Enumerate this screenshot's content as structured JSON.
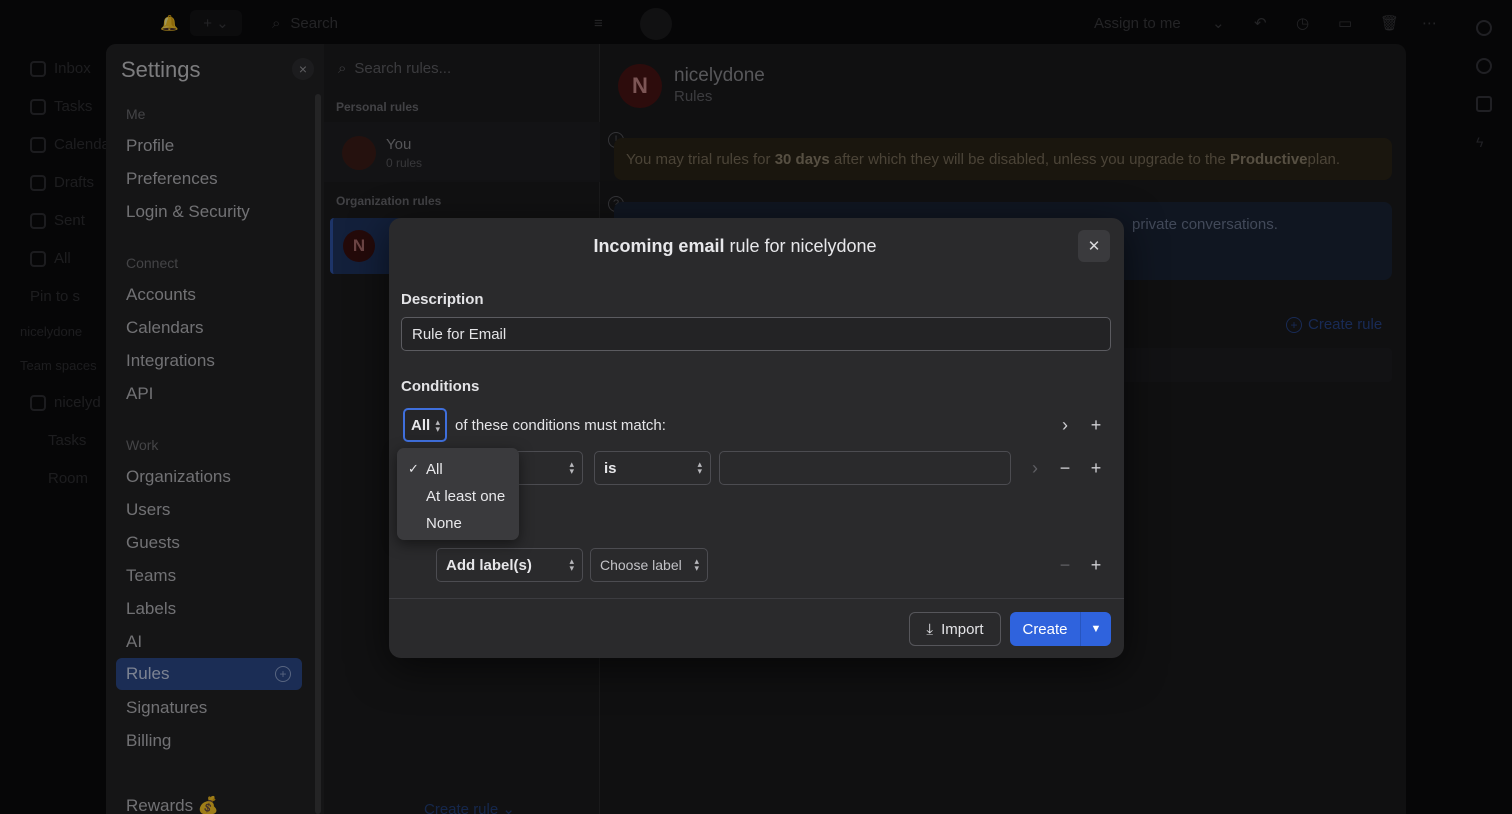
{
  "topbar": {
    "search_placeholder": "Search",
    "assign_label": "Assign to me"
  },
  "leftnav": {
    "items": [
      "Inbox",
      "Tasks",
      "Calendar",
      "Drafts",
      "Sent",
      "All",
      "Pin to s",
      "nicelydone",
      "Team spaces",
      "nicelyd",
      "Tasks",
      "Room"
    ]
  },
  "settings": {
    "title": "Settings",
    "close_icon": "×",
    "groups": {
      "me": "Me",
      "connect": "Connect",
      "work": "Work"
    },
    "me_items": [
      "Profile",
      "Preferences",
      "Login & Security"
    ],
    "connect_items": [
      "Accounts",
      "Calendars",
      "Integrations",
      "API"
    ],
    "work_items": [
      "Organizations",
      "Users",
      "Guests",
      "Teams",
      "Labels",
      "AI"
    ],
    "active_item": "Rules",
    "more_items": [
      "Signatures",
      "Billing"
    ],
    "rewards": "Rewards 💰"
  },
  "rules_column": {
    "search_placeholder": "Search rules...",
    "personal_label": "Personal rules",
    "you_name": "You",
    "you_sub": "0 rules",
    "org_label": "Organization rules",
    "org_initial": "N",
    "create_rule": "Create rule ⌄"
  },
  "main": {
    "org_initial": "N",
    "org_name": "nicelydone",
    "subtitle": "Rules",
    "trial_pre": "You may trial rules for ",
    "trial_days": "30 days",
    "trial_mid": " after which they will be disabled, unless you upgrade to the ",
    "trial_plan": "Productive",
    "trial_post": " plan.",
    "blue_text": "private conversations.",
    "create_rule": "Create rule"
  },
  "modal": {
    "title_bold": "Incoming email",
    "title_rest": " rule for nicelydone",
    "close_icon": "✕",
    "description_label": "Description",
    "description_value": "Rule for Email",
    "conditions_label": "Conditions",
    "match_value": "All",
    "match_text": "of these conditions must match:",
    "operator_value": "is",
    "action_value": "Add label(s)",
    "label_placeholder": "Choose label",
    "import_label": "Import",
    "create_label": "Create"
  },
  "dropdown": {
    "options": [
      "All",
      "At least one",
      "None"
    ],
    "selected": "All"
  },
  "colors": {
    "accent": "#2f63dd",
    "focus": "#3f6fdc",
    "modal_bg": "#2a2a2c"
  }
}
